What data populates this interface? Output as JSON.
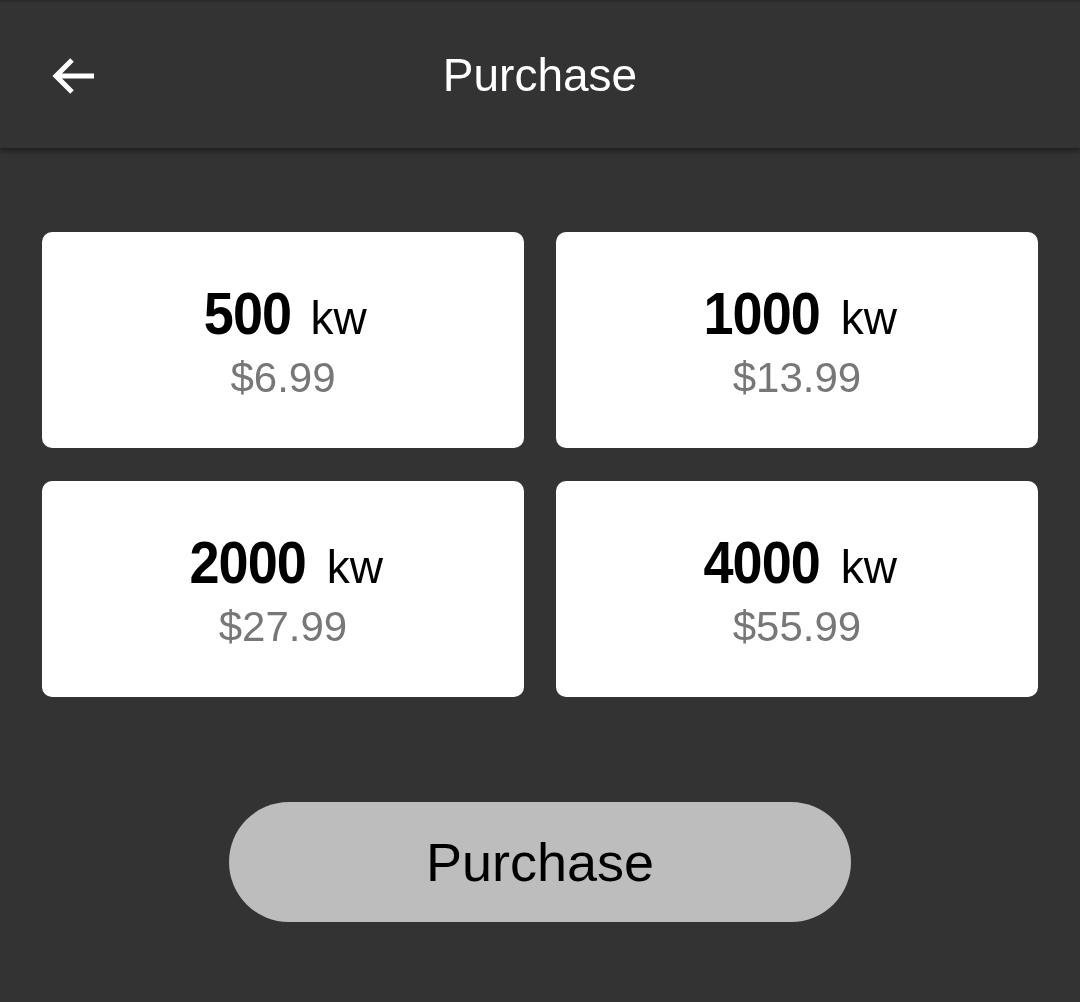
{
  "app_bar": {
    "title": "Purchase"
  },
  "packages": [
    {
      "amount": "500",
      "unit": "kw",
      "price": "$6.99",
      "selected": false
    },
    {
      "amount": "1000",
      "unit": "kw",
      "price": "$13.99",
      "selected": false
    },
    {
      "amount": "2000",
      "unit": "kw",
      "price": "$27.99",
      "selected": false
    },
    {
      "amount": "4000",
      "unit": "kw",
      "price": "$55.99",
      "selected": false
    }
  ],
  "purchase_button": {
    "label": "Purchase",
    "disabled": true
  }
}
